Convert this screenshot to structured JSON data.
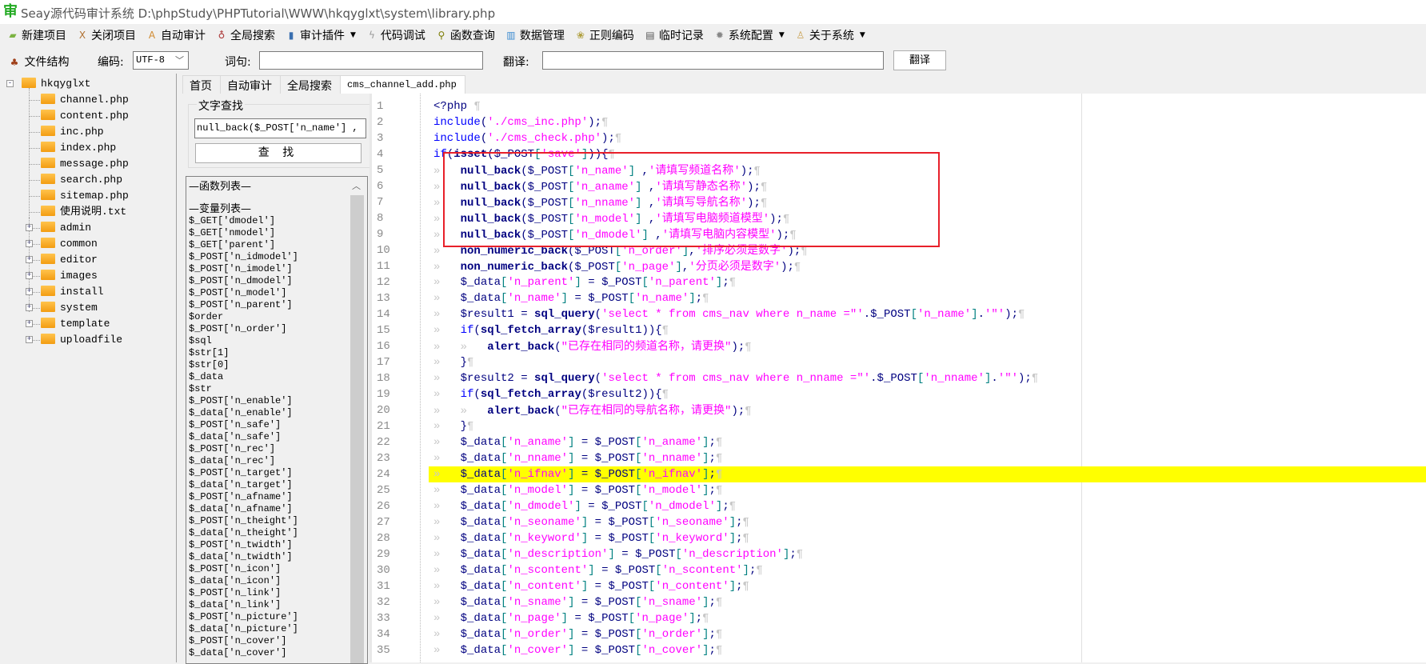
{
  "window": {
    "title": "Seay源代码审计系统  D:\\phpStudy\\PHPTutorial\\WWW\\hkqyglxt\\system\\library.php",
    "icon": "seay-logo-icon"
  },
  "toolbar": [
    {
      "label": "新建项目",
      "icon": "new-project-icon",
      "dropdown": false
    },
    {
      "label": "关闭项目",
      "icon": "close-project-icon",
      "dropdown": false
    },
    {
      "label": "自动审计",
      "icon": "auto-audit-icon",
      "dropdown": false
    },
    {
      "label": "全局搜索",
      "icon": "global-search-icon",
      "dropdown": false
    },
    {
      "label": "审计插件",
      "icon": "plugin-icon",
      "dropdown": true
    },
    {
      "label": "代码调试",
      "icon": "debug-icon",
      "dropdown": false
    },
    {
      "label": "函数查询",
      "icon": "function-search-icon",
      "dropdown": false
    },
    {
      "label": "数据管理",
      "icon": "data-manage-icon",
      "dropdown": false
    },
    {
      "label": "正则编码",
      "icon": "regex-icon",
      "dropdown": false
    },
    {
      "label": "临时记录",
      "icon": "notes-icon",
      "dropdown": false
    },
    {
      "label": "系统配置",
      "icon": "gear-icon",
      "dropdown": true
    },
    {
      "label": "关于系统",
      "icon": "about-icon",
      "dropdown": true
    }
  ],
  "row2": {
    "file_structure": "文件结构",
    "encoding_label": "编码:",
    "encoding_value": "UTF-8",
    "phrase_label": "词句:",
    "phrase_value": "",
    "translate_label": "翻译:",
    "translate_value": "",
    "translate_button": "翻译"
  },
  "tree": {
    "root": "hkqyglxt",
    "files": [
      "channel.php",
      "content.php",
      "inc.php",
      "index.php",
      "message.php",
      "search.php",
      "sitemap.php",
      "使用说明.txt"
    ],
    "folders": [
      "admin",
      "common",
      "editor",
      "images",
      "install",
      "system",
      "template",
      "uploadfile"
    ]
  },
  "tabs": [
    {
      "label": "首页",
      "active": false
    },
    {
      "label": "自动审计",
      "active": false
    },
    {
      "label": "全局搜索",
      "active": false
    },
    {
      "label": "cms_channel_add.php",
      "active": true
    }
  ],
  "search": {
    "group_label": "文字查找",
    "input_value": "null_back($_POST['n_name'] ,",
    "button": "查 找"
  },
  "function_list": {
    "func_header": "—函数列表—",
    "var_header": "—变量列表—",
    "variables": [
      "$_GET['dmodel']",
      "$_GET['nmodel']",
      "$_GET['parent']",
      "$_POST['n_idmodel']",
      "$_POST['n_imodel']",
      "$_POST['n_dmodel']",
      "$_POST['n_model']",
      "$_POST['n_parent']",
      "$order",
      "$_POST['n_order']",
      "$sql",
      "$str[1]",
      "$str[0]",
      "$_data",
      "$str",
      "$_POST['n_enable']",
      "$_data['n_enable']",
      "$_POST['n_safe']",
      "$_data['n_safe']",
      "$_POST['n_rec']",
      "$_data['n_rec']",
      "$_POST['n_target']",
      "$_data['n_target']",
      "$_POST['n_afname']",
      "$_data['n_afname']",
      "$_POST['n_theight']",
      "$_data['n_theight']",
      "$_POST['n_twidth']",
      "$_data['n_twidth']",
      "$_POST['n_icon']",
      "$_data['n_icon']",
      "$_POST['n_link']",
      "$_data['n_link']",
      "$_POST['n_picture']",
      "$_data['n_picture']",
      "$_POST['n_cover']",
      "$_data['n_cover']"
    ]
  },
  "editor": {
    "highlighted_line": 24,
    "highlight_color": "#ffff00",
    "annotation_color": "#e8202a",
    "annotated_lines": [
      5,
      9
    ],
    "lines": [
      "<?php ",
      "include('./cms_inc.php');",
      "include('./cms_check.php');",
      "if(isset($_POST['save'])){",
      "\tnull_back($_POST['n_name'] ,'请填写频道名称');",
      "\tnull_back($_POST['n_aname'] ,'请填写静态名称');",
      "\tnull_back($_POST['n_nname'] ,'请填写导航名称');",
      "\tnull_back($_POST['n_model'] ,'请填写电脑频道模型');",
      "\tnull_back($_POST['n_dmodel'] ,'请填写电脑内容模型');",
      "\tnon_numeric_back($_POST['n_order'],'排序必须是数字');",
      "\tnon_numeric_back($_POST['n_page'],'分页必须是数字');",
      "\t$_data['n_parent'] = $_POST['n_parent'];",
      "\t$_data['n_name'] = $_POST['n_name'];",
      "\t$result1 = sql_query('select * from cms_nav where n_name =\"'.$_POST['n_name'].'\"');",
      "\tif(sql_fetch_array($result1)){",
      "\t\talert_back(\"已存在相同的频道名称，请更换\");",
      "\t}",
      "\t$result2 = sql_query('select * from cms_nav where n_nname =\"'.$_POST['n_nname'].'\"');",
      "\tif(sql_fetch_array($result2)){",
      "\t\talert_back(\"已存在相同的导航名称，请更换\");",
      "\t}",
      "\t$_data['n_aname'] = $_POST['n_aname'];",
      "\t$_data['n_nname'] = $_POST['n_nname'];",
      "\t$_data['n_ifnav'] = $_POST['n_ifnav'];",
      "\t$_data['n_model'] = $_POST['n_model'];",
      "\t$_data['n_dmodel'] = $_POST['n_dmodel'];",
      "\t$_data['n_seoname'] = $_POST['n_seoname'];",
      "\t$_data['n_keyword'] = $_POST['n_keyword'];",
      "\t$_data['n_description'] = $_POST['n_description'];",
      "\t$_data['n_scontent'] = $_POST['n_scontent'];",
      "\t$_data['n_content'] = $_POST['n_content'];",
      "\t$_data['n_sname'] = $_POST['n_sname'];",
      "\t$_data['n_page'] = $_POST['n_page'];",
      "\t$_data['n_order'] = $_POST['n_order'];",
      "\t$_data['n_cover'] = $_POST['n_cover'];"
    ]
  }
}
